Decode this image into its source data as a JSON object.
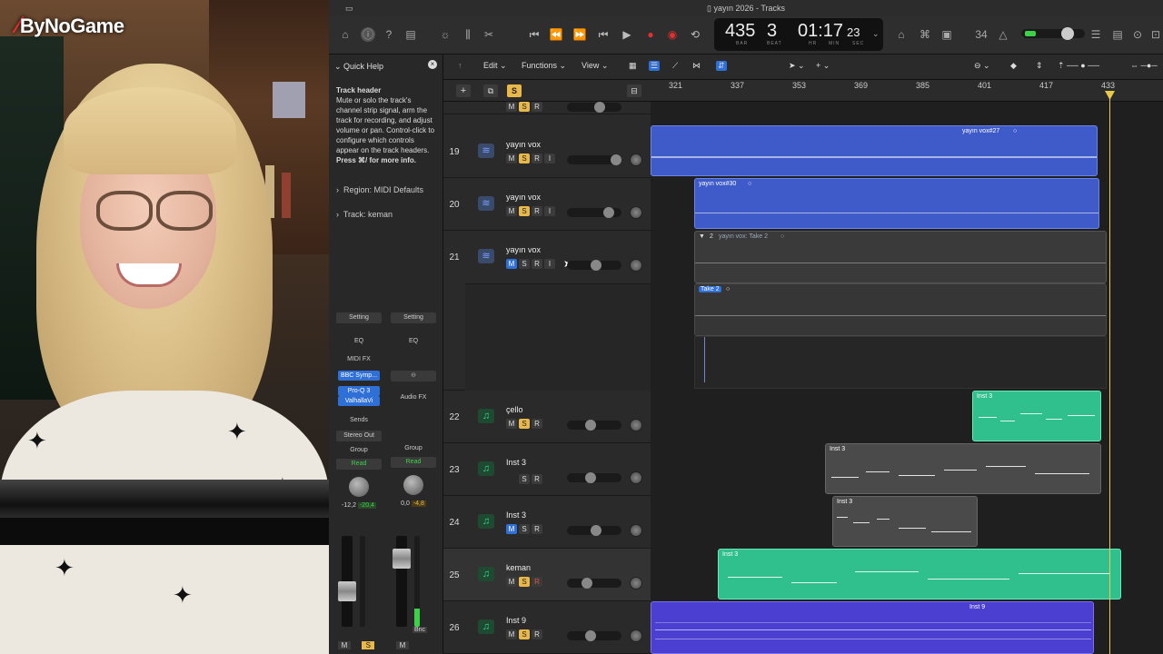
{
  "webcam": {
    "logo": "ByNoGame"
  },
  "window": {
    "title": "yayın 2026 - Tracks"
  },
  "lcd": {
    "bar": "435",
    "beat": "3",
    "time": "01:17",
    "frames": "23",
    "bar_lbl": "BAR",
    "beat_lbl": "BEAT",
    "hr_lbl": "HR",
    "min_lbl": "MIN",
    "sec_lbl": "SEC"
  },
  "toolbar": {
    "count_in": "34"
  },
  "quick_help": {
    "title": "Quick Help",
    "heading": "Track header",
    "body": "Mute or solo the track's channel strip signal, arm the track for recording, and adjust volume or pan. Control-click to configure which controls appear on the track headers.",
    "more": "Press ⌘/ for more info.",
    "region_label": "Region:",
    "region_value": "MIDI Defaults",
    "track_label": "Track:",
    "track_value": "keman"
  },
  "strip_left": {
    "setting": "Setting",
    "eq": "EQ",
    "midi_fx": "MIDI FX",
    "instrument": "BBC Symp...",
    "fx1": "Pro-Q 3",
    "fx2": "ValhallaVi",
    "sends": "Sends",
    "output": "Stereo Out",
    "group": "Group",
    "auto": "Read",
    "val1": "-12,2",
    "val2": "-20,4",
    "m": "M",
    "s": "S"
  },
  "strip_right": {
    "setting": "Setting",
    "eq": "EQ",
    "audio_fx": "Audio FX",
    "group": "Group",
    "auto": "Read",
    "val1": "0,0",
    "val2": "-4,8",
    "bnc": "Bnc",
    "m": "M"
  },
  "local_toolbar": {
    "edit": "Edit",
    "functions": "Functions",
    "view": "View"
  },
  "header_top": {
    "solo": "S"
  },
  "ruler": [
    "321",
    "337",
    "353",
    "369",
    "385",
    "401",
    "417",
    "433"
  ],
  "tracks": [
    {
      "num": "19",
      "name": "yayın vox",
      "type": "audio",
      "m": "M",
      "s": "S",
      "r": "R",
      "i": "I"
    },
    {
      "num": "20",
      "name": "yayın vox",
      "type": "audio",
      "m": "M",
      "s": "S",
      "r": "R",
      "i": "I"
    },
    {
      "num": "21",
      "name": "yayın vox",
      "type": "audio",
      "m": "M",
      "s": "S",
      "r": "R",
      "i": "I"
    },
    {
      "num": "22",
      "name": "çello",
      "type": "inst",
      "m": "M",
      "s": "S",
      "r": "R"
    },
    {
      "num": "23",
      "name": "Inst 3",
      "type": "inst",
      "m": "",
      "s": "S",
      "r": "R"
    },
    {
      "num": "24",
      "name": "Inst 3",
      "type": "inst",
      "m": "M",
      "s": "S",
      "r": "R"
    },
    {
      "num": "25",
      "name": "keman",
      "type": "inst",
      "m": "M",
      "s": "S",
      "r": "R"
    },
    {
      "num": "26",
      "name": "Inst 9",
      "type": "inst",
      "m": "M",
      "s": "S",
      "r": "R"
    }
  ],
  "regions": {
    "r19": "yayın vox#27",
    "r20": "yayın vox#30",
    "r21_folder_num": "2",
    "r21_folder": "yayın vox: Take 2",
    "r21_take": "Take 2",
    "r22": "Inst 3",
    "r23": "Inst 3",
    "r24": "Inst 3",
    "r25": "Inst 3",
    "r26": "Inst 9"
  },
  "colors": {
    "audio_region": "#3f5bc9",
    "midi_green": "#2fc08e",
    "midi_grey": "#4a4a4a",
    "inst9": "#4a3fd1",
    "solo": "#e8b94a",
    "playhead": "#e8c94a"
  }
}
